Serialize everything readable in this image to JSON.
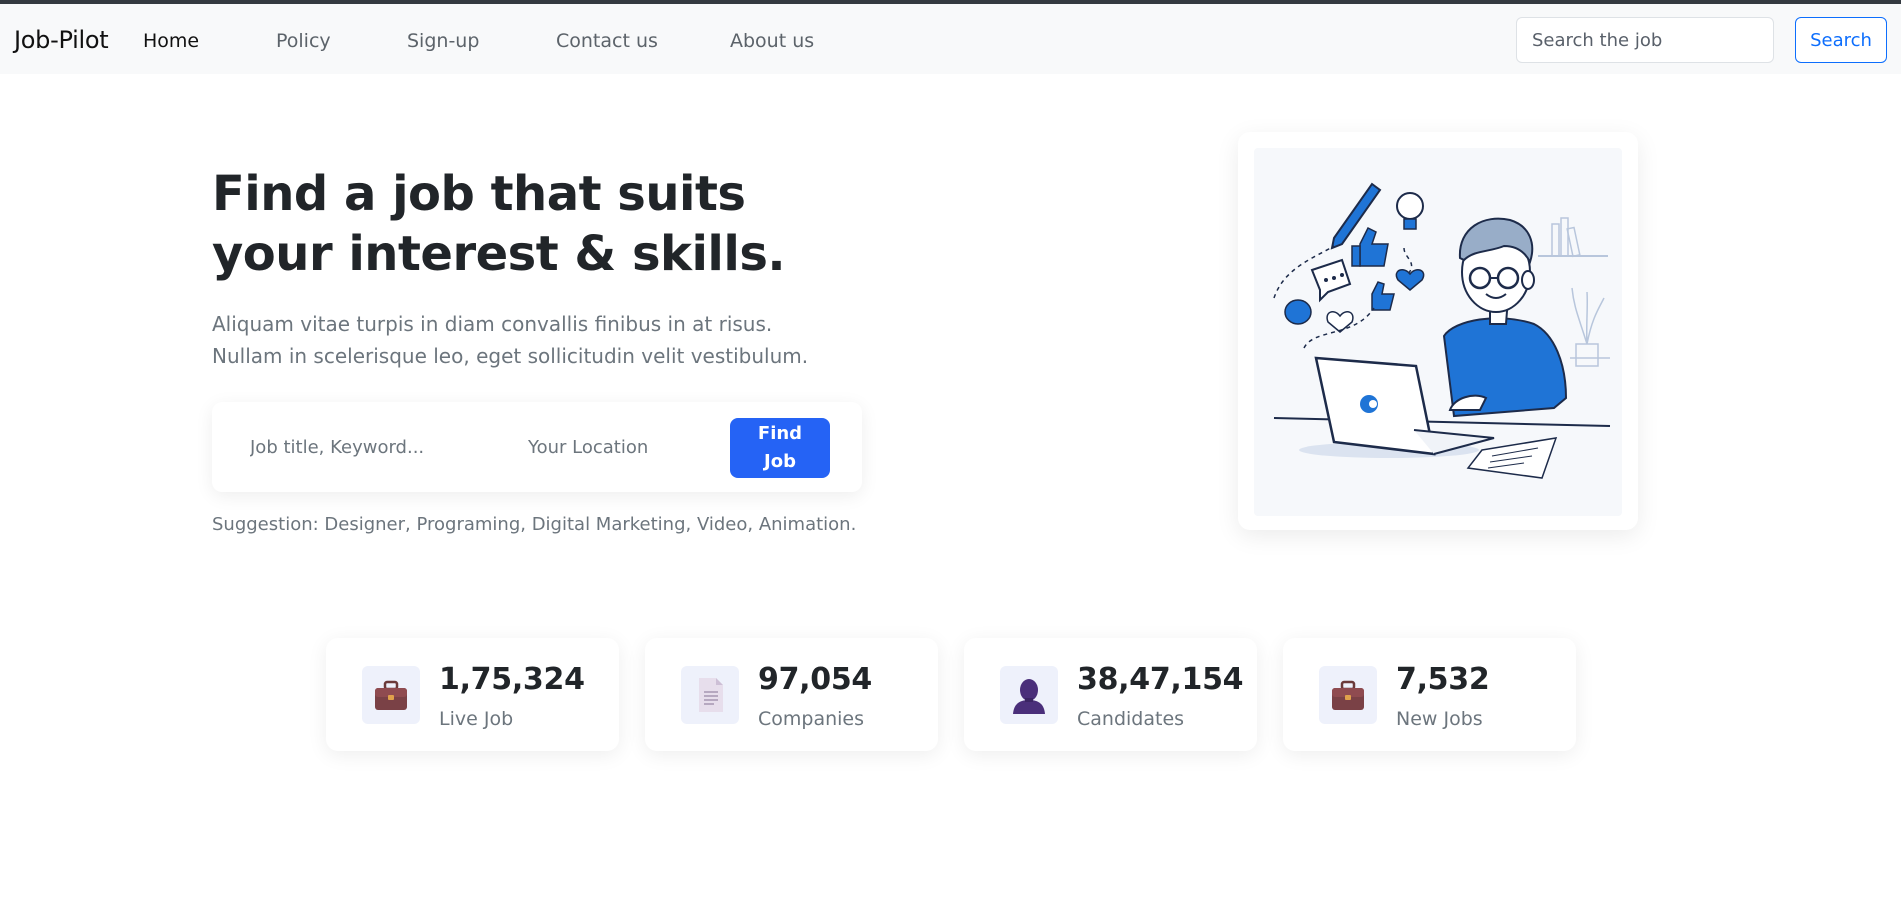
{
  "navbar": {
    "brand": "Job-Pilot",
    "links": [
      {
        "label": "Home",
        "active": true
      },
      {
        "label": "Policy",
        "active": false
      },
      {
        "label": "Sign-up",
        "active": false
      },
      {
        "label": "Contact us",
        "active": false
      },
      {
        "label": "About us",
        "active": false
      }
    ],
    "search_placeholder": "Search the job",
    "search_button": "Search"
  },
  "hero": {
    "title_line1": "Find a job that suits",
    "title_line2": "your interest & skills.",
    "description": "Aliquam vitae turpis in diam convallis finibus in at risus. Nullam in scelerisque leo, eget sollicitudin velit vestibulum.",
    "job_placeholder": "Job title, Keyword...",
    "location_placeholder": "Your Location",
    "find_button": "Find\nJob",
    "suggestion": "Suggestion: Designer, Programing, Digital Marketing, Video, Animation."
  },
  "stats": [
    {
      "value": "1,75,324",
      "label": "Live Job",
      "icon": "briefcase-icon"
    },
    {
      "value": "97,054",
      "label": "Companies",
      "icon": "document-icon"
    },
    {
      "value": "38,47,154",
      "label": "Candidates",
      "icon": "user-icon"
    },
    {
      "value": "7,532",
      "label": "New Jobs",
      "icon": "briefcase-icon"
    }
  ],
  "colors": {
    "primary": "#2563f5",
    "outline_primary": "#0d6efd",
    "navbar_bg": "#f8f9fa",
    "illustration_blue": "#1f74d6"
  }
}
